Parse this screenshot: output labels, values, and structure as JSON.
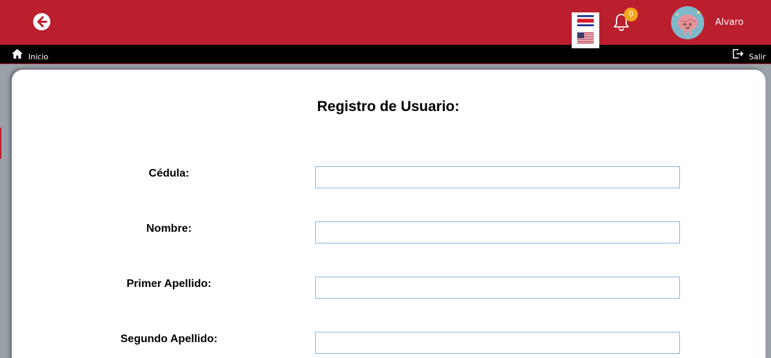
{
  "header": {
    "username": "Alvaro",
    "notifications_count": "0"
  },
  "languages": [
    {
      "name": "Español (Costa Rica)",
      "icon": "costa-rica-flag-icon"
    },
    {
      "name": "English (US)",
      "icon": "us-flag-icon"
    }
  ],
  "nav": {
    "home_label": "Inicio",
    "exit_label": "Salir"
  },
  "form": {
    "title": "Registro de Usuario:",
    "fields": [
      {
        "label": "Cédula:",
        "value": ""
      },
      {
        "label": "Nombre:",
        "value": ""
      },
      {
        "label": "Primer Apellido:",
        "value": ""
      },
      {
        "label": "Segundo Apellido:",
        "value": ""
      }
    ]
  },
  "colors": {
    "brand_red": "#bb1e2d",
    "navbar": "#000000",
    "badge": "#f2a81d",
    "input_border": "#86b9dc"
  }
}
